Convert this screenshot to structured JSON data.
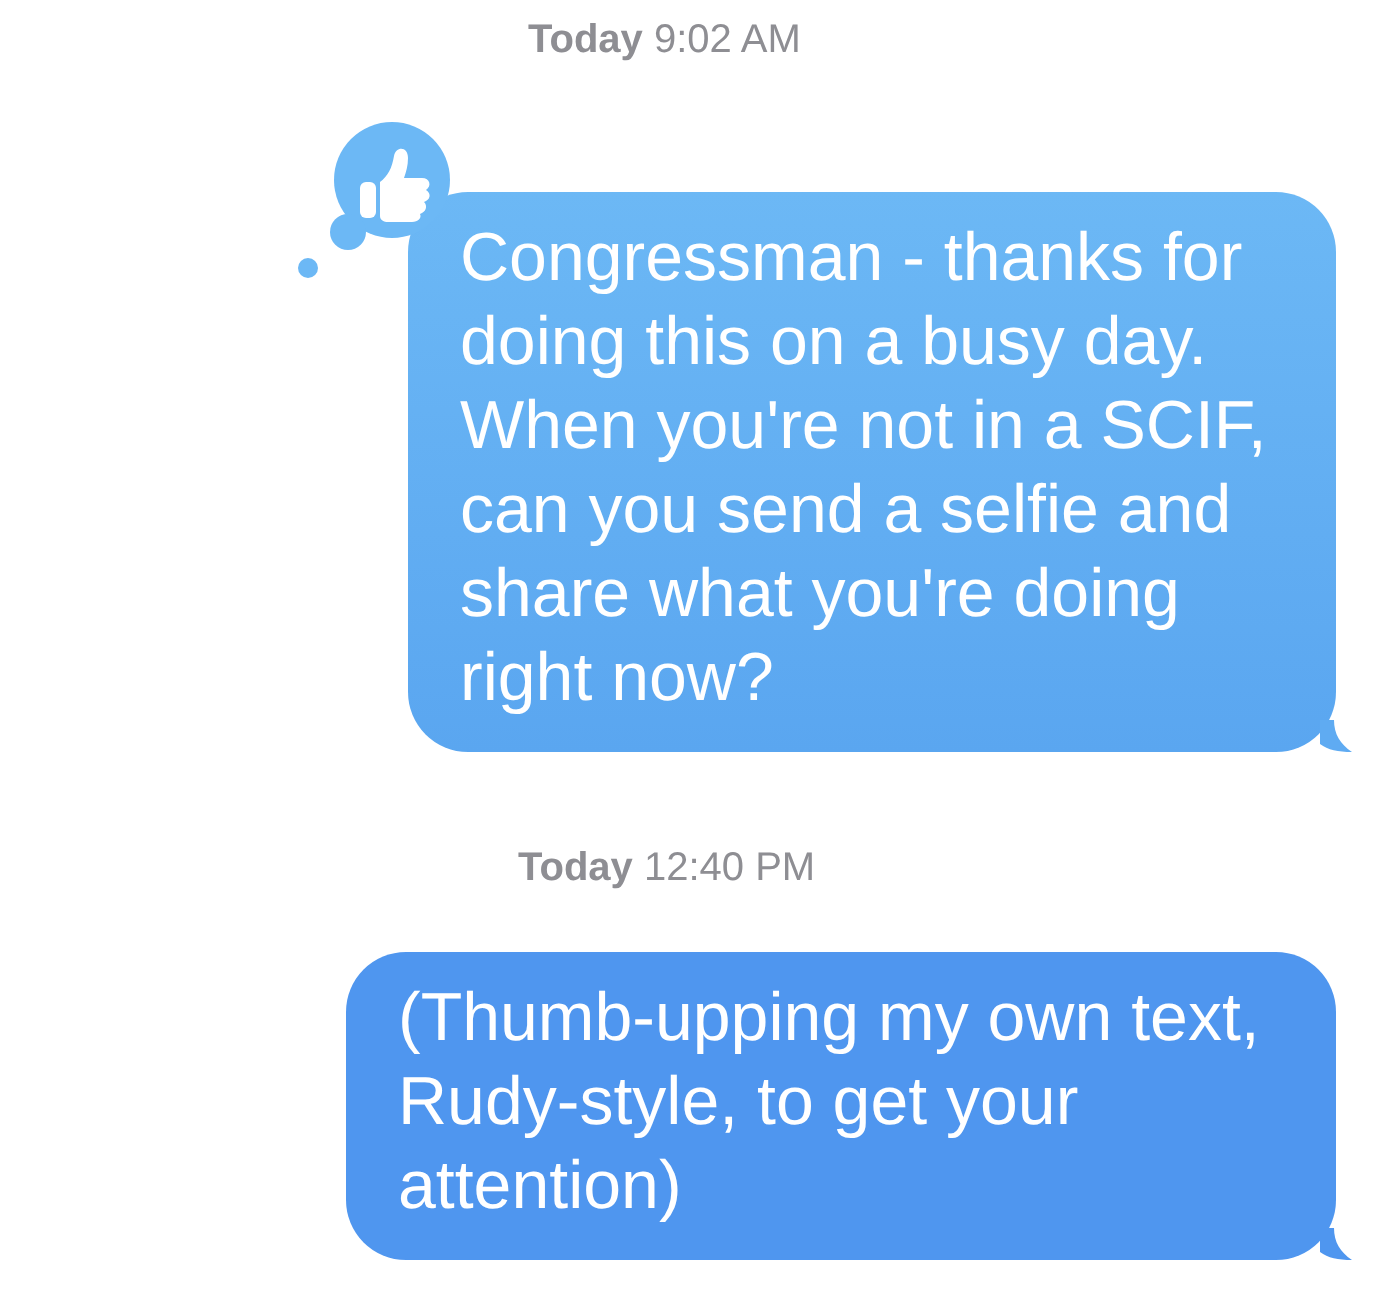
{
  "messages": [
    {
      "timestamp": "**Today** 9:02 AM",
      "text": "Congressman - thanks for doing this on a busy day. When you're not in a SCIF, can you send a selfie and share what you're doing right now?",
      "tapback": {
        "kind": "like"
      },
      "kind": "earlier"
    },
    {
      "timestamp": "**Today** 12:40 PM",
      "text": "(Thumb-upping my own text, Rudy-style, to get your attention)",
      "kind": "latest"
    }
  ]
}
